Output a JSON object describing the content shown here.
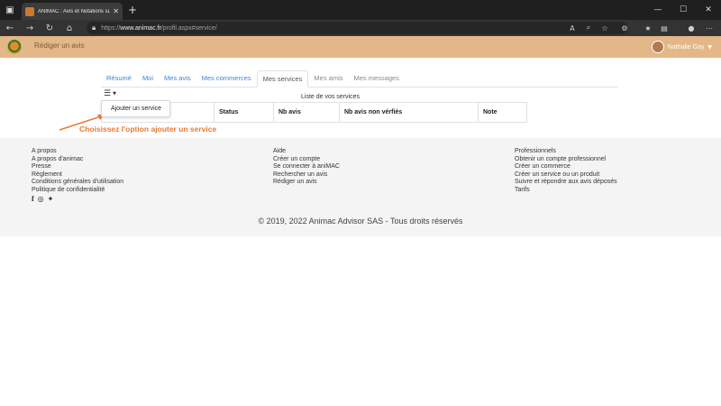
{
  "browser": {
    "tab_title": "ANIMAC : Avis et Notations sur",
    "url_scheme": "https://",
    "url_domain": "www.animac.fr",
    "url_path": "/profil.aspx#service/"
  },
  "header": {
    "write_review": "Rédiger un avis",
    "user_name": "Nathalie Gay"
  },
  "tabs": [
    {
      "label": "Résumé"
    },
    {
      "label": "Moi"
    },
    {
      "label": "Mes avis"
    },
    {
      "label": "Mes commerces"
    },
    {
      "label": "Mes services"
    },
    {
      "label": "Mes amis"
    },
    {
      "label": "Mes messages"
    }
  ],
  "services": {
    "list_title": "Liste de vos services",
    "dropdown_item": "Ajouter un service",
    "columns": [
      "",
      "Status",
      "Nb avis",
      "Nb avis non vérfiés",
      "Note"
    ]
  },
  "annotation": {
    "text": "Choisissez l'option ajouter un service",
    "color": "#e87a35"
  },
  "footer": {
    "col1": [
      "A propos",
      "A propos d'animac",
      "Presse",
      "Règlement",
      "Conditions générales d'utilisation",
      "Politique de confidentialité"
    ],
    "col2": [
      "Aide",
      "Créer un compte",
      "Se connecter à aniMAC",
      "Rechercher un avis",
      "Rédiger un avis"
    ],
    "col3": [
      "Professionnels",
      "Obtenir un compte professionnel",
      "Créer un commerce",
      "Créer un service ou un produit",
      "Suivre et répondre aux avis déposés",
      "Tarifs"
    ],
    "copyright": "© 2019, 2022 Animac Advisor SAS - Tous droits réservés"
  },
  "colors": {
    "header_bg": "#e3b787",
    "link": "#3a86d4"
  }
}
